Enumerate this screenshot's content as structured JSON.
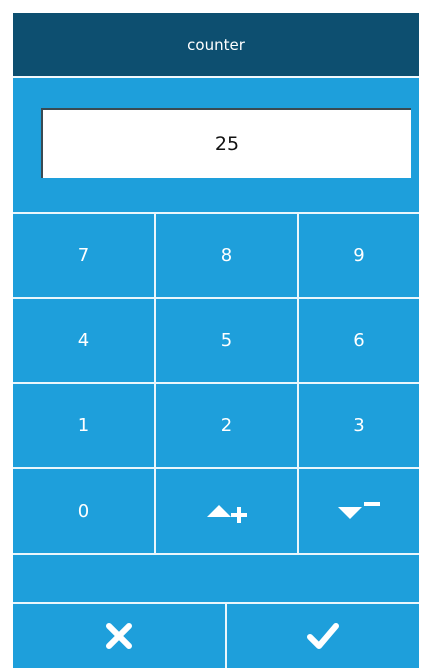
{
  "header": {
    "title": "counter"
  },
  "display": {
    "value": "25"
  },
  "keypad": {
    "keys": [
      "7",
      "8",
      "9",
      "4",
      "5",
      "6",
      "1",
      "2",
      "3",
      "0"
    ],
    "increment_icon": "up-plus-icon",
    "decrement_icon": "down-minus-icon"
  },
  "actions": {
    "cancel_icon": "close-icon",
    "confirm_icon": "checkmark-icon"
  },
  "colors": {
    "title_bar": "#0d4f70",
    "panel": "#1e9fdb",
    "separator": "#eaf6fc",
    "display_bg": "#ffffff",
    "text_light": "#ffffff"
  }
}
